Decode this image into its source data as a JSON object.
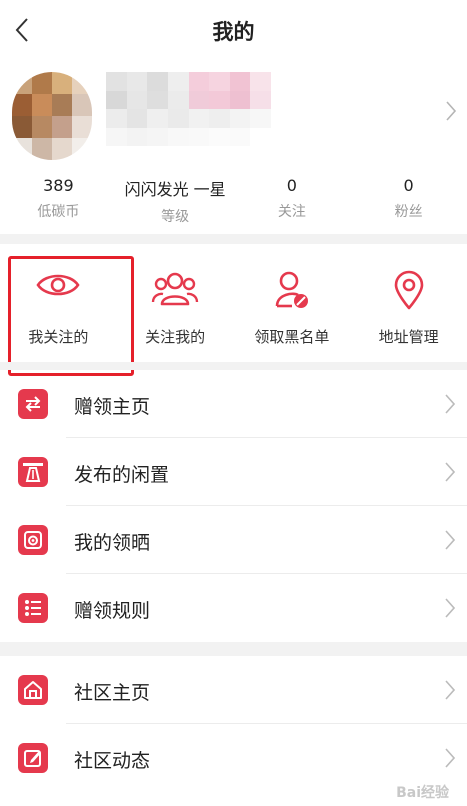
{
  "header": {
    "title": "我的"
  },
  "profile": {
    "avatar_colors": [
      "#c9a27a",
      "#b07a4a",
      "#d8b07c",
      "#e6d1bc",
      "#9b5e34",
      "#c98c5a",
      "#a87c56",
      "#d9c6b8",
      "#8a5a36",
      "#b78962",
      "#c4a08c",
      "#e9ded6",
      "#e8e2dc",
      "#cdb7a6",
      "#e5d8cd",
      "#f2eeea"
    ],
    "name_colors": [
      "#e2e2e2",
      "#e8e8e8",
      "#dcdcdc",
      "#eeeeee",
      "#f4cddb",
      "#f6d4e0",
      "#f1c3d3",
      "#f8e3ea",
      "#d8d8d8",
      "#e6e6e6",
      "#dedede",
      "#ebebeb",
      "#f0cbd9",
      "#f3c9d8",
      "#eec0d1",
      "#f6dfe8",
      "#ececec",
      "#e4e4e4",
      "#efefef",
      "#eaeaea",
      "#f1f1f1",
      "#eeeeee",
      "#f3f3f3",
      "#f7f7f7",
      "#f6f6f6",
      "#f3f3f3",
      "#f5f5f5",
      "#f8f8f8",
      "#f9f9f9",
      "#fbfbfb",
      "#fafafa",
      "#ffffff"
    ]
  },
  "stats": [
    {
      "value": "389",
      "label": "低碳币"
    },
    {
      "value": "闪闪发光 一星",
      "label": "等级"
    },
    {
      "value": "0",
      "label": "关注"
    },
    {
      "value": "0",
      "label": "粉丝"
    }
  ],
  "grid": [
    {
      "label": "我关注的",
      "icon": "eye-icon"
    },
    {
      "label": "关注我的",
      "icon": "users-icon"
    },
    {
      "label": "领取黑名单",
      "icon": "user-block-icon"
    },
    {
      "label": "地址管理",
      "icon": "location-icon"
    }
  ],
  "menu_group1": [
    {
      "label": "赠领主页",
      "icon": "swap-icon"
    },
    {
      "label": "发布的闲置",
      "icon": "road-icon"
    },
    {
      "label": "我的领晒",
      "icon": "camera-icon"
    },
    {
      "label": "赠领规则",
      "icon": "list-icon"
    }
  ],
  "menu_group2": [
    {
      "label": "社区主页",
      "icon": "home-icon"
    },
    {
      "label": "社区动态",
      "icon": "edit-icon"
    }
  ],
  "colors": {
    "accent": "#e5394d",
    "highlight": "#e5202a",
    "separator": "#f2f2f2"
  },
  "watermark": "Bai经验"
}
